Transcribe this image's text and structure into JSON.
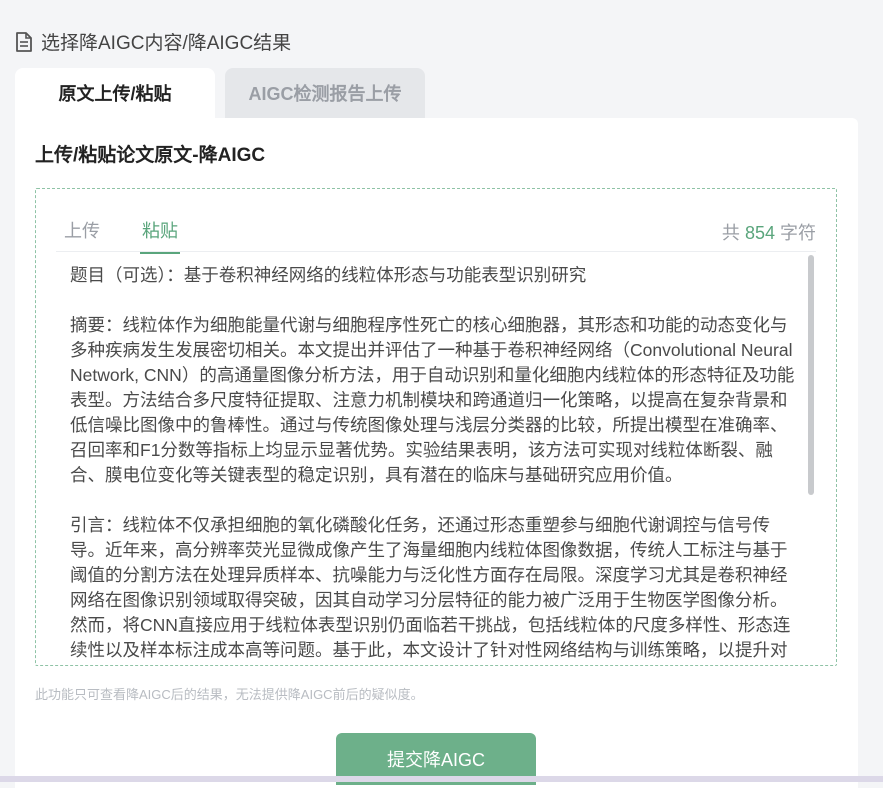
{
  "header": {
    "icon": "document-icon",
    "title": "选择降AIGC内容/降AIGC结果"
  },
  "tabs": [
    {
      "label": "原文上传/粘贴",
      "active": true
    },
    {
      "label": "AIGC检测报告上传",
      "active": false
    }
  ],
  "card": {
    "title": "上传/粘贴论文原文-降AIGC",
    "subtabs": [
      {
        "label": "上传",
        "active": false
      },
      {
        "label": "粘贴",
        "active": true
      }
    ],
    "count": {
      "prefix": "共",
      "value": "854",
      "suffix": "字符"
    },
    "content": {
      "title_line": "题目（可选）：基于卷积神经网络的线粒体形态与功能表型识别研究",
      "abstract": "摘要：线粒体作为细胞能量代谢与细胞程序性死亡的核心细胞器，其形态和功能的动态变化与多种疾病发生发展密切相关。本文提出并评估了一种基于卷积神经网络（Convolutional Neural Network, CNN）的高通量图像分析方法，用于自动识别和量化细胞内线粒体的形态特征及功能表型。方法结合多尺度特征提取、注意力机制模块和跨通道归一化策略，以提高在复杂背景和低信噪比图像中的鲁棒性。通过与传统图像处理与浅层分类器的比较，所提出模型在准确率、召回率和F1分数等指标上均显示显著优势。实验结果表明，该方法可实现对线粒体断裂、融合、膜电位变化等关键表型的稳定识别，具有潜在的临床与基础研究应用价值。",
      "intro": "引言：线粒体不仅承担细胞的氧化磷酸化任务，还通过形态重塑参与细胞代谢调控与信号传导。近年来，高分辨率荧光显微成像产生了海量细胞内线粒体图像数据，传统人工标注与基于阈值的分割方法在处理异质样本、抗噪能力与泛化性方面存在局限。深度学习尤其是卷积神经网络在图像识别领域取得突破，因其自动学习分层特征的能力被广泛用于生物医学图像分析。然而，将CNN直接应用于线粒体表型识别仍面临若干挑战，包括线粒体的尺度多样性、形态连续性以及样本标注成本高等问题。基于此，本文设计了针对性网络结构与训练策略，以提升对"
    },
    "note": "此功能只可查看降AIGC后的结果，无法提供降AIGC前后的疑似度。",
    "submit_label": "提交降AIGC"
  },
  "colors": {
    "accent": "#5aa57c",
    "button": "#6db08a",
    "border": "#8fc3a6"
  }
}
